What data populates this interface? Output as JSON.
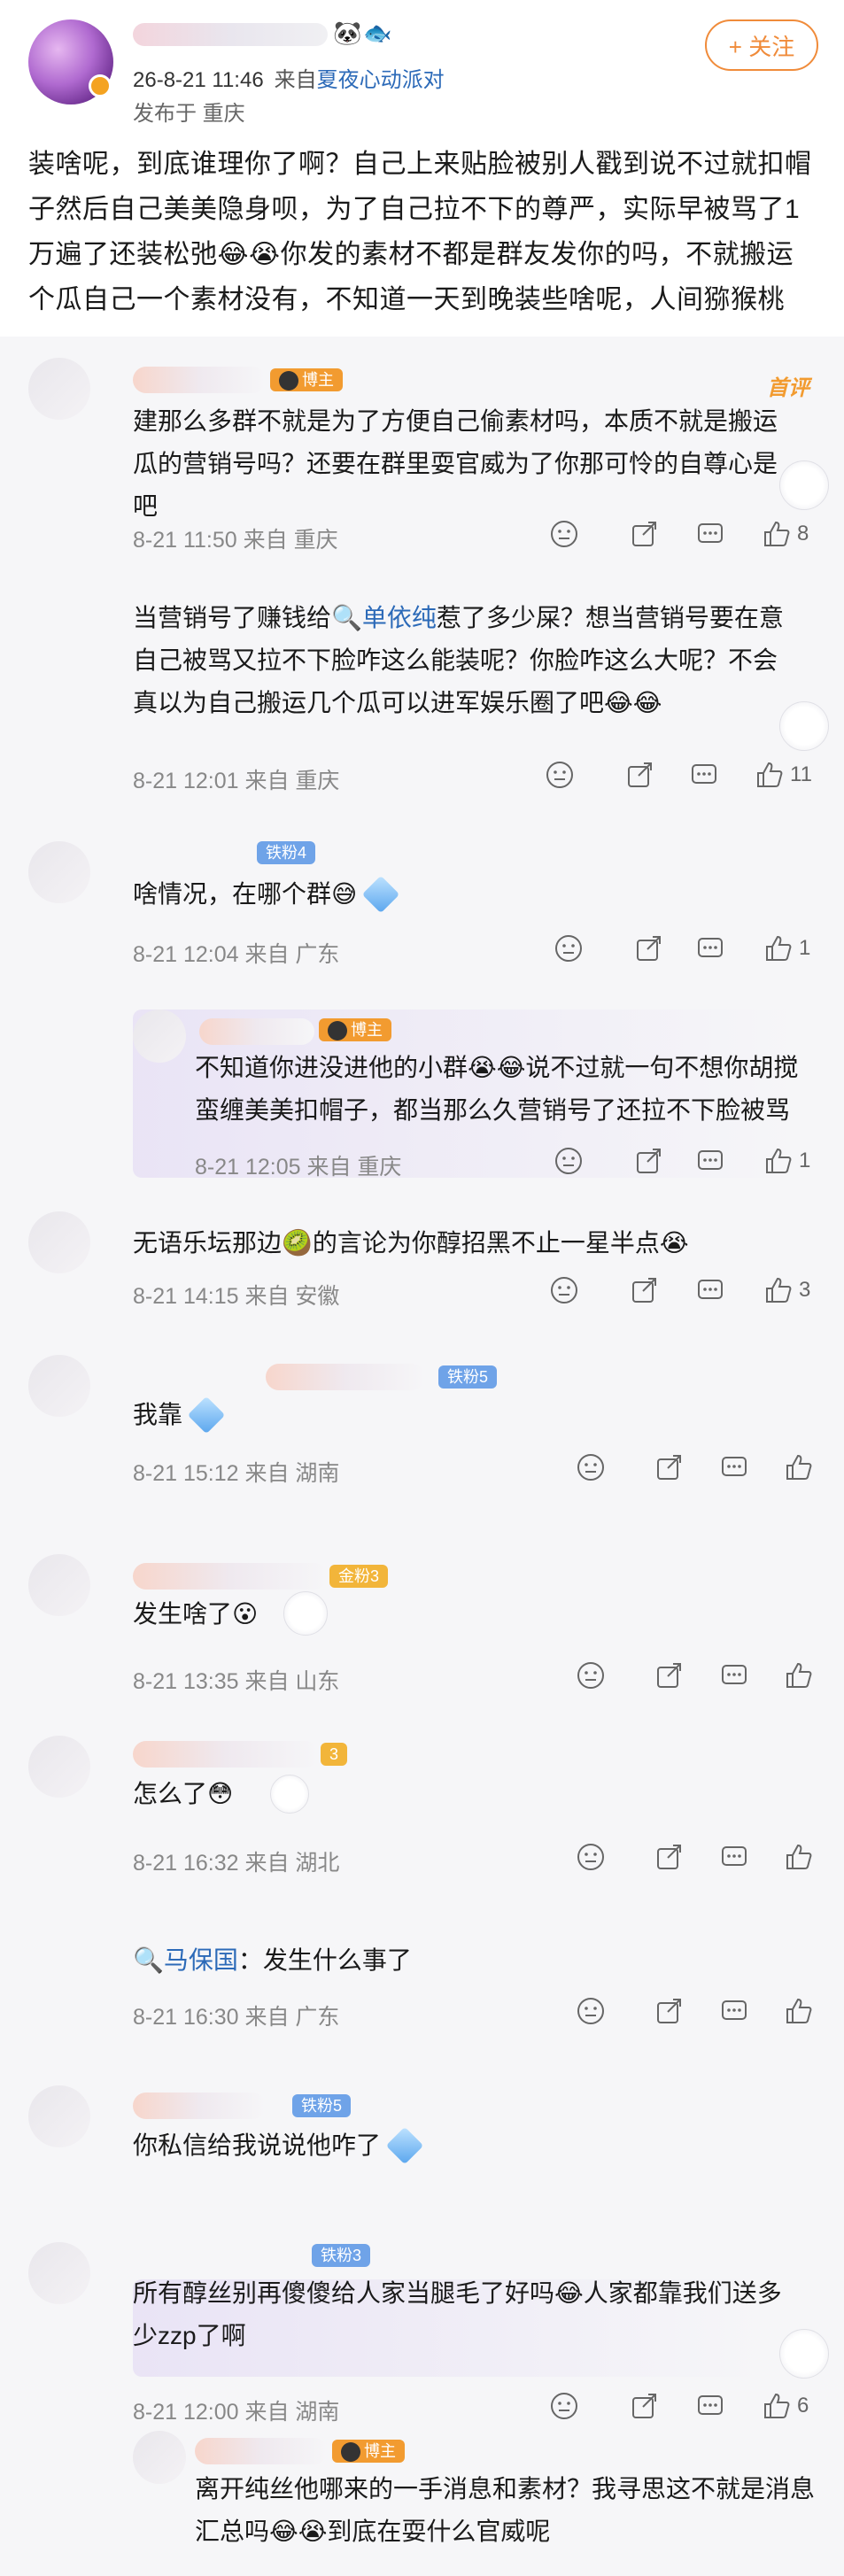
{
  "post": {
    "time": "26-8-21 11:46",
    "from_prefix": "来自",
    "source": "夏夜心动派对",
    "location": "发布于 重庆",
    "follow_label": "+ 关注",
    "body": "装啥呢，到底谁理你了啊？自己上来贴脸被别人戳到说不过就扣帽子然后自己美美隐身呗，为了自己拉不下的尊严，实际早被骂了1万遍了还装松弛😂😭你发的素材不都是群友发你的吗，不就搬运个瓜自己一个素材没有，不知道一天到晚装些啥呢，人间猕猴桃"
  },
  "labels": {
    "host_badge": "博主",
    "pinned": "首评"
  },
  "comments": [
    {
      "badge": "博主",
      "text": "建那么多群不就是为了方便自己偷素材吗，本质不就是搬运瓜的营销号吗？还要在群里耍官威为了你那可怜的自尊心是吧",
      "meta": "8-21 11:50  来自 重庆",
      "likes": "8"
    },
    {
      "text_prefix": "当营销号了赚钱给",
      "mention": "单依纯",
      "text_suffix": "惹了多少屎？想当营销号要在意自己被骂又拉不下脸咋这么能装呢？你脸咋这么大呢？不会真以为自己搬运几个瓜可以进军娱乐圈了吧😂😂",
      "meta": "8-21 12:01  来自 重庆",
      "likes": "11"
    },
    {
      "badge": "铁粉4",
      "text": "啥情况，在哪个群😅",
      "meta": "8-21 12:04  来自 广东",
      "likes": "1"
    },
    {
      "badge": "博主",
      "text": "不知道你进没进他的小群😭😂说不过就一句不想你胡搅蛮缠美美扣帽子，都当那么久营销号了还拉不下脸被骂",
      "meta": "8-21 12:05  来自 重庆",
      "likes": "1"
    },
    {
      "text": "无语乐坛那边🥝的言论为你醇招黑不止一星半点😭",
      "meta": "8-21 14:15  来自 安徽",
      "likes": "3"
    },
    {
      "badge": "铁粉5",
      "text": "我靠",
      "meta": "8-21 15:12  来自 湖南",
      "likes": ""
    },
    {
      "badge": "金粉3",
      "text": "发生啥了😮",
      "meta": "8-21 13:35  来自 山东",
      "likes": ""
    },
    {
      "badge": "3",
      "text": "怎么了😳",
      "meta": "8-21 16:32  来自 湖北",
      "likes": ""
    },
    {
      "mention": "马保国",
      "text": "：发生什么事了",
      "meta": "8-21 16:30  来自 广东",
      "likes": ""
    },
    {
      "badge": "铁粉5",
      "text": "你私信给我说说他咋了",
      "meta": "",
      "likes": ""
    },
    {
      "badge": "铁粉3",
      "text": "所有醇丝别再傻傻给人家当腿毛了好吗😂人家都靠我们送多少zzp了啊",
      "meta": "8-21 12:00  来自 湖南",
      "likes": "6"
    },
    {
      "badge": "博主",
      "text": "离开纯丝他哪来的一手消息和素材？我寻思这不就是消息汇总吗😂😭到底在耍什么官威呢",
      "meta": "",
      "likes": ""
    }
  ]
}
